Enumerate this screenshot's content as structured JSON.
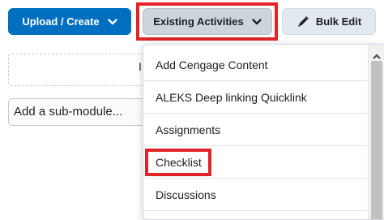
{
  "toolbar": {
    "upload_create_label": "Upload / Create",
    "existing_activities_label": "Existing Activities",
    "bulk_edit_label": "Bulk Edit"
  },
  "content": {
    "add_sub_module_placeholder": "Add a sub-module...",
    "peek_text": "I"
  },
  "menu": {
    "items": [
      {
        "label": "Add Cengage Content"
      },
      {
        "label": "ALEKS Deep linking Quicklink"
      },
      {
        "label": "Assignments"
      },
      {
        "label": "Checklist"
      },
      {
        "label": "Discussions"
      }
    ]
  },
  "colors": {
    "primary": "#006fbf",
    "highlight": "#e32228",
    "secondary_button": "#cdd5dc",
    "bulk_button": "#e3e9f1"
  },
  "icons": {
    "chevron": "chevron-down-icon",
    "pencil": "pencil-icon",
    "scroll_up": "scroll-up-arrow-icon"
  }
}
